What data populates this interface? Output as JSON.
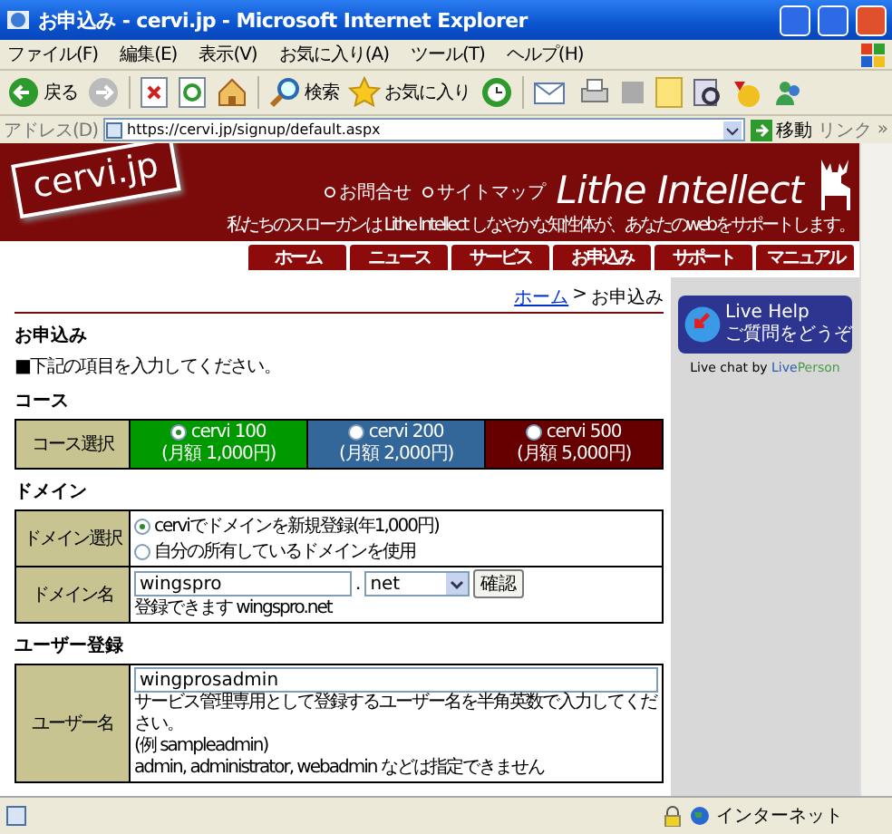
{
  "window": {
    "title": "お申込み - cervi.jp - Microsoft Internet Explorer"
  },
  "menu_bar": [
    "ファイル(F)",
    "編集(E)",
    "表示(V)",
    "お気に入り(A)",
    "ツール(T)",
    "ヘルプ(H)"
  ],
  "toolbar": {
    "back": "戻る",
    "search": "検索",
    "favorites": "お気に入り"
  },
  "address_bar": {
    "label": "アドレス(D)",
    "url": "https://cervi.jp/signup/default.aspx",
    "go": "移動",
    "links": "リンク",
    "more": "»"
  },
  "header": {
    "logo": "cervi.jp",
    "links": [
      "お問合せ",
      "サイトマップ"
    ],
    "brand": "Lithe Intellect",
    "slogan": "私たちのスローガンは Lithe Intellect しなやかな知性体が、あなたのwebをサポートします。"
  },
  "nav": [
    "ホーム",
    "ニュース",
    "サービス",
    "お申込み",
    "サポート",
    "マニュアル"
  ],
  "breadcrumb": {
    "link": "ホーム",
    "separator": ">",
    "current": "お申込み"
  },
  "page_title": "お申込み",
  "instruction": "■下記の項目を入力してください。",
  "course": {
    "heading": "コース",
    "label": "コース選択",
    "options": [
      {
        "name": "cervi 100",
        "price": "(月額 1,000円)",
        "color": "#009900",
        "selected": true
      },
      {
        "name": "cervi 200",
        "price": "(月額 2,000円)",
        "color": "#336699",
        "selected": false
      },
      {
        "name": "cervi 500",
        "price": "(月額 5,000円)",
        "color": "#660000",
        "selected": false
      }
    ]
  },
  "domain": {
    "heading": "ドメイン",
    "choice_label": "ドメイン選択",
    "choices": [
      {
        "label": "cerviでドメインを新規登録(年1,000円)",
        "selected": true
      },
      {
        "label": "自分の所有しているドメインを使用",
        "selected": false
      }
    ],
    "name_label": "ドメイン名",
    "name_value": "wingspro",
    "dot": ".",
    "tld": "net",
    "check_button": "確認",
    "status": "登録できます wingspro.net"
  },
  "user": {
    "heading": "ユーザー登録",
    "label": "ユーザー名",
    "value": "wingprosadmin",
    "help": "サービス管理専用として登録するユーザー名を半角英数で入力してください。",
    "example": "(例 sampleadmin)",
    "note": "admin, administrator, webadmin などは指定できません"
  },
  "sidebar": {
    "live_help": {
      "title": "Live Help",
      "subtitle": "ご質問をどうぞ"
    },
    "credit": {
      "prefix": "Live chat by",
      "brand_1": "Live",
      "brand_2": "Person"
    }
  },
  "status_bar": {
    "zone": "インターネット"
  }
}
